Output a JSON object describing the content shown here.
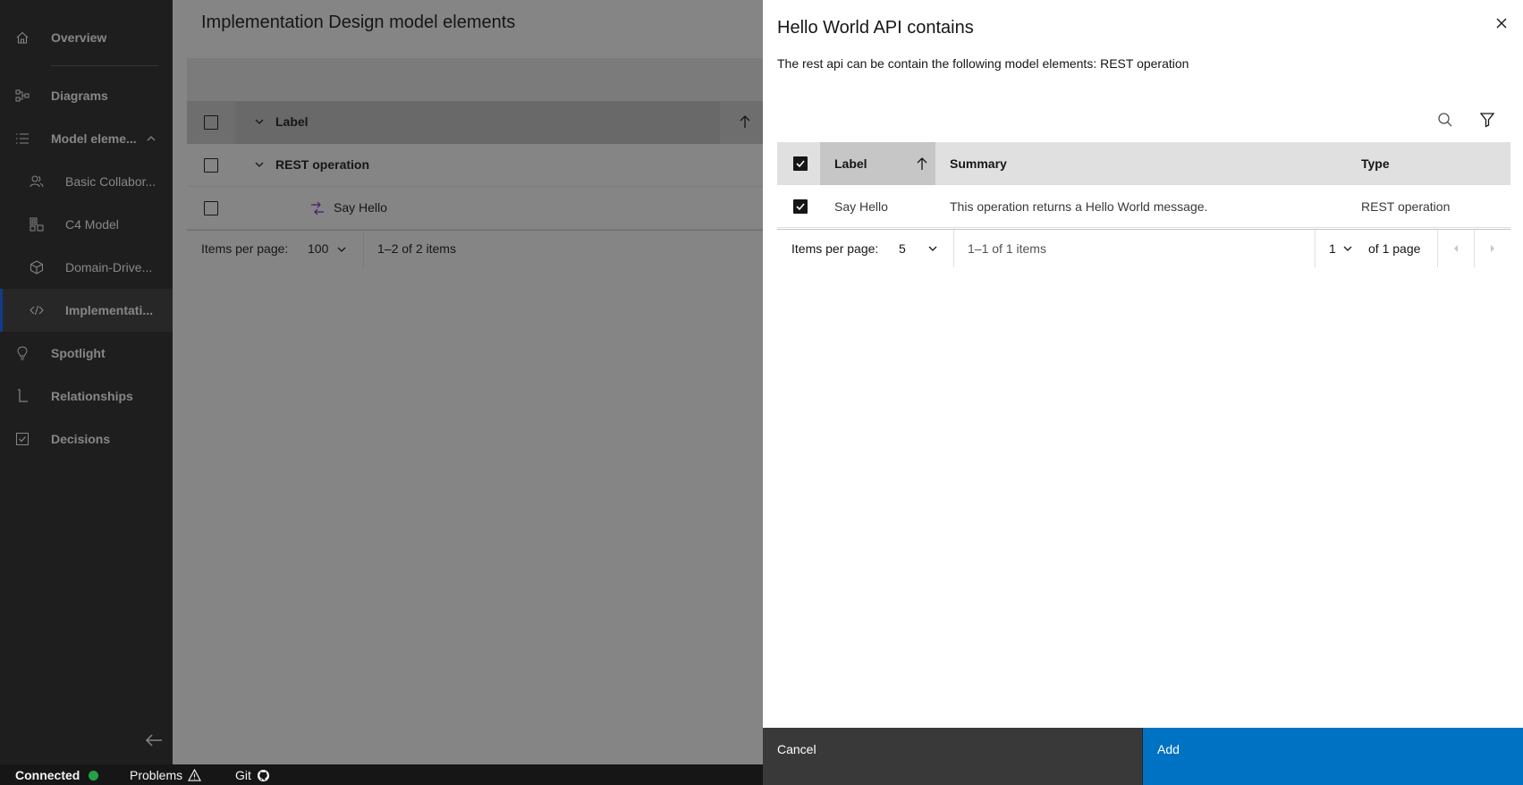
{
  "sidebar": {
    "items": [
      {
        "label": "Overview",
        "icon": "home-icon"
      },
      {
        "label": "Diagrams",
        "icon": "diagram-icon"
      },
      {
        "label": "Model eleme...",
        "icon": "list-icon"
      },
      {
        "label": "Basic Collabor...",
        "icon": "users-icon"
      },
      {
        "label": "C4 Model",
        "icon": "c4-icon"
      },
      {
        "label": "Domain-Drive...",
        "icon": "cube-icon"
      },
      {
        "label": "Implementati...",
        "icon": "code-icon"
      },
      {
        "label": "Spotlight",
        "icon": "lightbulb-icon"
      },
      {
        "label": "Relationships",
        "icon": "relationship-icon"
      },
      {
        "label": "Decisions",
        "icon": "checkbox-icon"
      }
    ]
  },
  "statusbar": {
    "connected": "Connected",
    "problems": "Problems",
    "git": "Git",
    "connected_color": "#24a148"
  },
  "main": {
    "title": "Implementation Design model elements",
    "table": {
      "header_label": "Label",
      "group_label": "REST operation",
      "row_label": "Say Hello",
      "items_per_page_label": "Items per page:",
      "items_per_page_value": "100",
      "range": "1–2 of 2 items"
    }
  },
  "dialog": {
    "title": "Hello World API contains",
    "description": "The rest api can be contain the following model elements: REST operation",
    "table": {
      "columns": [
        "Label",
        "Summary",
        "Type"
      ],
      "rows": [
        {
          "label": "Say Hello",
          "summary": "This operation returns a Hello World message.",
          "type": "REST operation",
          "checked": true
        }
      ],
      "items_per_page_label": "Items per page:",
      "items_per_page_value": "5",
      "range": "1–1 of 1 items",
      "page_value": "1",
      "page_total": "of 1 page"
    },
    "cancel_label": "Cancel",
    "add_label": "Add",
    "accent_color": "#0072c3"
  }
}
